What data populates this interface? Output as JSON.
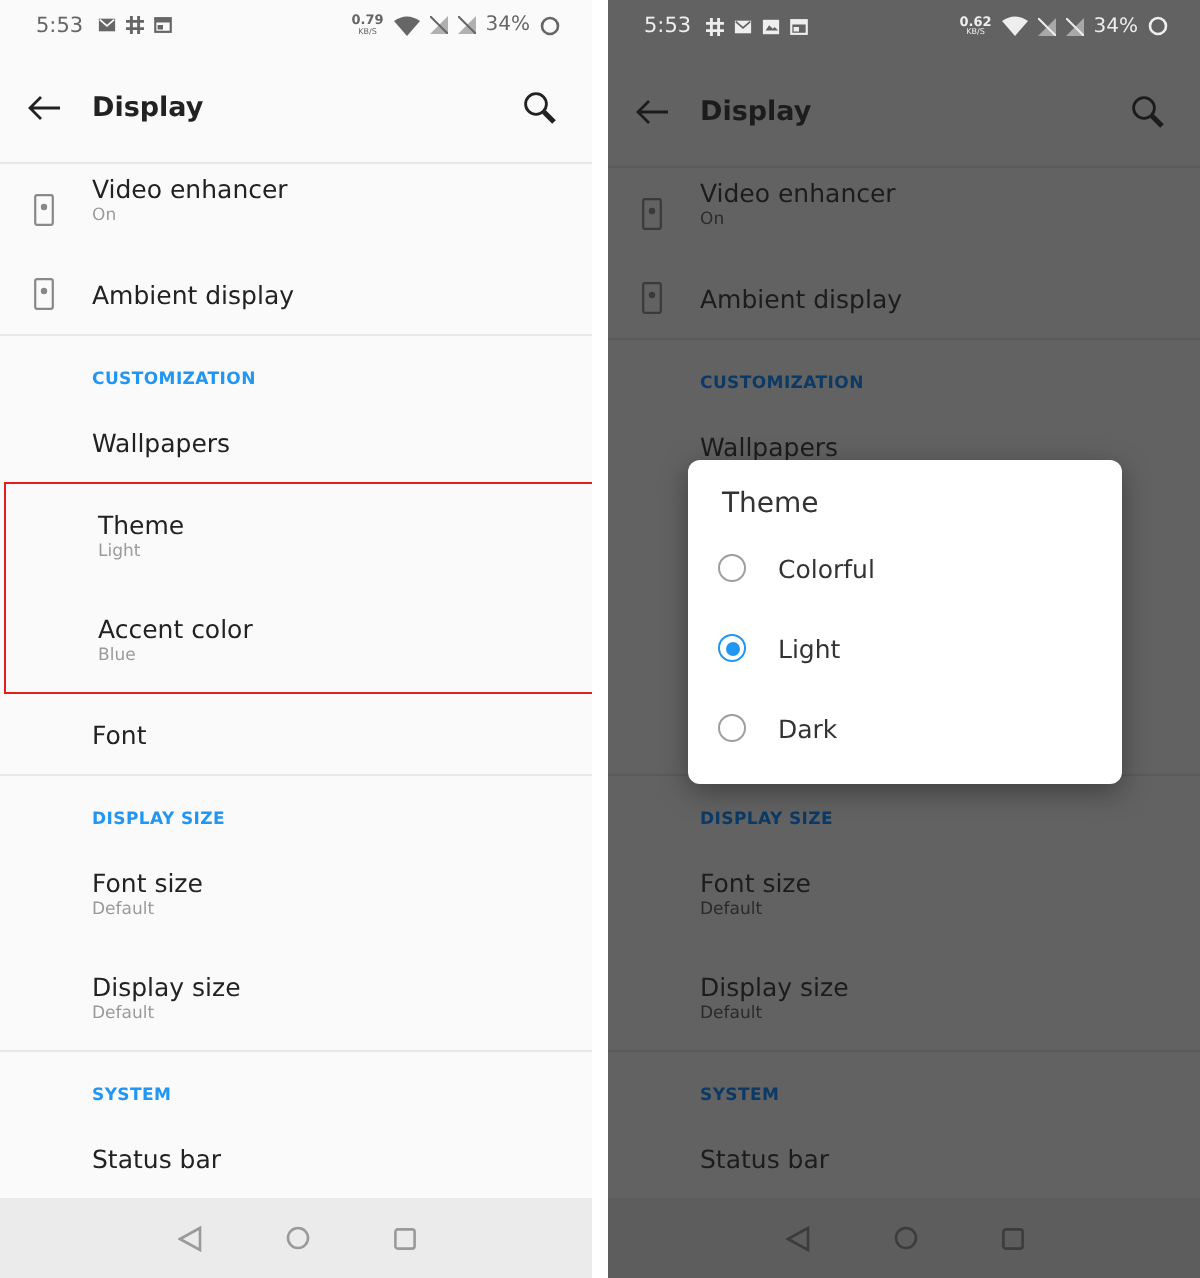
{
  "phones": [
    {
      "dimmed": false,
      "status_bar": {
        "time": "5:53",
        "notifications": [
          {
            "kind": "mail"
          },
          {
            "kind": "hash"
          },
          {
            "kind": "calendar"
          }
        ],
        "speed": "0.79",
        "speed_unit": "KB/S",
        "battery": "34%"
      },
      "toolbar": {
        "title": "Display"
      },
      "items": [
        {
          "kind": "icon_row",
          "title": "Video enhancer",
          "subtitle": "On",
          "clipped": true
        },
        {
          "kind": "icon_row",
          "title": "Ambient display"
        },
        {
          "kind": "header",
          "title": "CUSTOMIZATION"
        },
        {
          "kind": "row",
          "title": "Wallpapers"
        },
        {
          "kind": "highlight",
          "children": [
            {
              "kind": "row",
              "title": "Theme",
              "subtitle": "Light"
            },
            {
              "kind": "row",
              "title": "Accent color",
              "subtitle": "Blue"
            }
          ]
        },
        {
          "kind": "row",
          "title": "Font"
        },
        {
          "kind": "header",
          "title": "DISPLAY SIZE"
        },
        {
          "kind": "row",
          "title": "Font size",
          "subtitle": "Default"
        },
        {
          "kind": "row",
          "title": "Display size",
          "subtitle": "Default"
        },
        {
          "kind": "header",
          "title": "SYSTEM"
        },
        {
          "kind": "row",
          "title": "Status bar"
        }
      ]
    },
    {
      "dimmed": true,
      "status_bar": {
        "time": "5:53",
        "notifications": [
          {
            "kind": "hash"
          },
          {
            "kind": "mail"
          },
          {
            "kind": "image"
          },
          {
            "kind": "calendar"
          }
        ],
        "speed": "0.62",
        "speed_unit": "KB/S",
        "battery": "34%"
      },
      "toolbar": {
        "title": "Display"
      },
      "items": [
        {
          "kind": "icon_row",
          "title": "Video enhancer",
          "subtitle": "On",
          "clipped": true
        },
        {
          "kind": "icon_row",
          "title": "Ambient display"
        },
        {
          "kind": "header",
          "title": "CUSTOMIZATION"
        },
        {
          "kind": "row",
          "title": "Wallpapers"
        },
        {
          "kind": "dialog",
          "title": "Theme",
          "options": [
            {
              "label": "Colorful",
              "selected": false
            },
            {
              "label": "Light",
              "selected": true
            },
            {
              "label": "Dark",
              "selected": false
            }
          ]
        },
        {
          "kind": "header",
          "title": "DISPLAY SIZE"
        },
        {
          "kind": "row",
          "title": "Font size",
          "subtitle": "Default"
        },
        {
          "kind": "row",
          "title": "Display size",
          "subtitle": "Default"
        },
        {
          "kind": "header",
          "title": "SYSTEM"
        },
        {
          "kind": "row",
          "title": "Status bar"
        }
      ]
    }
  ]
}
